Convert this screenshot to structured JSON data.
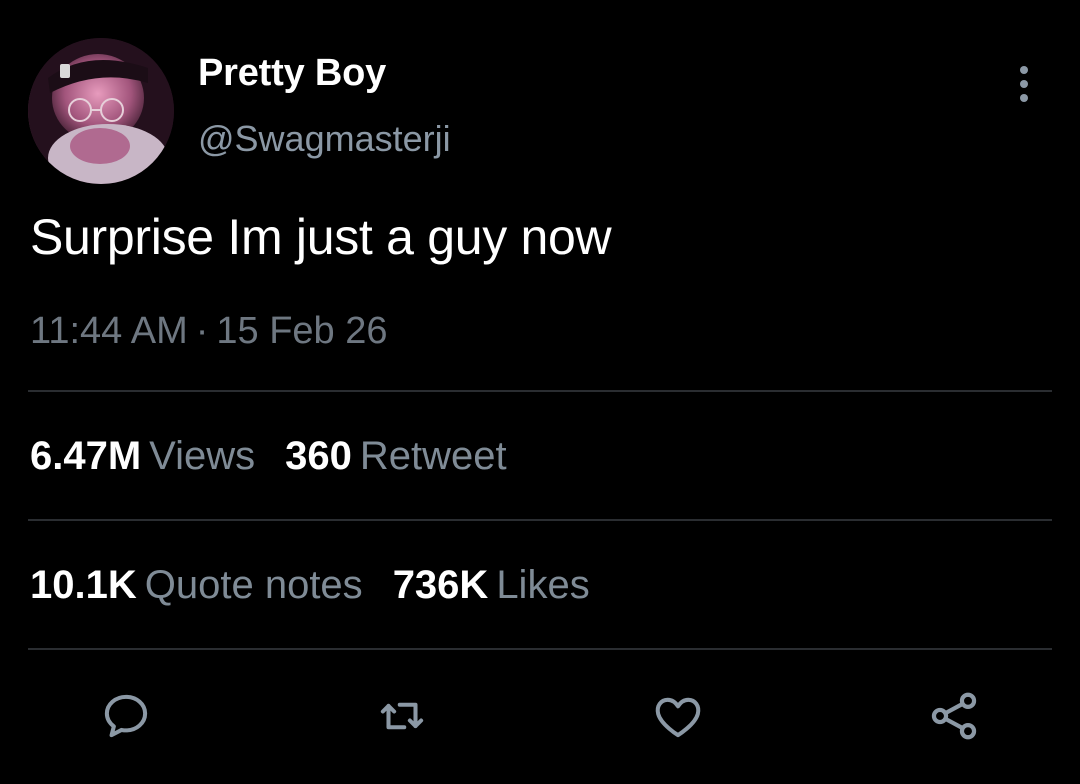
{
  "author": {
    "name": "Pretty Boy",
    "handle": "@Swagmasterji",
    "avatar_icon": "profile-photo"
  },
  "tweet": {
    "text": "Surprise Im just a guy now",
    "time": "11:44 AM",
    "separator": "·",
    "date": "15 Feb 26"
  },
  "stats": {
    "views_count": "6.47M",
    "views_label": "Views",
    "retweets_count": "360",
    "retweets_label": "Retweet",
    "quotes_count": "10.1K",
    "quotes_label": "Quote notes",
    "likes_count": "736K",
    "likes_label": "Likes"
  },
  "actions": {
    "reply_icon": "speech-bubble-icon",
    "retweet_icon": "retweet-arrows-icon",
    "like_icon": "heart-icon",
    "share_icon": "share-nodes-icon"
  },
  "colors": {
    "background": "#000000",
    "primary_text": "#ffffff",
    "secondary_text": "#8b98a5",
    "divider": "#2a2d31"
  }
}
